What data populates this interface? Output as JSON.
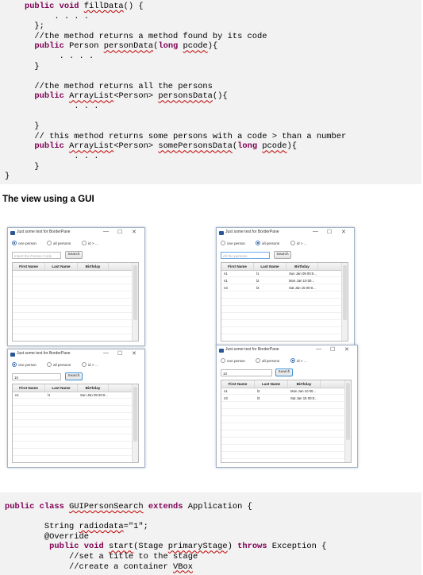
{
  "top_code": [
    [
      {
        "t": "    "
      },
      {
        "t": "public void ",
        "c": "kw"
      },
      {
        "t": "fillData",
        "c": "sq"
      },
      {
        "t": "() {"
      }
    ],
    [
      {
        "t": "          . . . ."
      }
    ],
    [
      {
        "t": "      };"
      }
    ],
    [
      {
        "t": "      //the method returns a method found by its code",
        "c": "cmt"
      }
    ],
    [
      {
        "t": "      "
      },
      {
        "t": "public ",
        "c": "kw"
      },
      {
        "t": "Person "
      },
      {
        "t": "personData",
        "c": "sq"
      },
      {
        "t": "("
      },
      {
        "t": "long ",
        "c": "kw"
      },
      {
        "t": "pcode",
        "c": "sq"
      },
      {
        "t": "){"
      }
    ],
    [
      {
        "t": "           . . . ."
      }
    ],
    [
      {
        "t": "      }"
      }
    ],
    [
      {
        "t": ""
      }
    ],
    [
      {
        "t": "      //the method returns all the persons",
        "c": "cmt"
      }
    ],
    [
      {
        "t": "      "
      },
      {
        "t": "public ",
        "c": "kw"
      },
      {
        "t": "ArrayList",
        "c": "sq"
      },
      {
        "t": "<Person> "
      },
      {
        "t": "personsData",
        "c": "sq"
      },
      {
        "t": "(){"
      }
    ],
    [
      {
        "t": "              . . ."
      }
    ],
    [
      {
        "t": ""
      }
    ],
    [
      {
        "t": "      }"
      }
    ],
    [
      {
        "t": "      // this method returns some persons with a code > than a number",
        "c": "cmt"
      }
    ],
    [
      {
        "t": "      "
      },
      {
        "t": "public ",
        "c": "kw"
      },
      {
        "t": "ArrayList",
        "c": "sq"
      },
      {
        "t": "<Person> "
      },
      {
        "t": "somePersonsData",
        "c": "sq"
      },
      {
        "t": "("
      },
      {
        "t": "long ",
        "c": "kw"
      },
      {
        "t": "pcode",
        "c": "sq"
      },
      {
        "t": "){"
      }
    ],
    [
      {
        "t": "              . . ."
      }
    ],
    [
      {
        "t": "      }"
      }
    ],
    [
      {
        "t": "}"
      }
    ]
  ],
  "heading": "The view using a GUI",
  "window_title": "Just some test for BorderPane",
  "window_controls": [
    "—",
    "☐",
    "✕"
  ],
  "radio_labels": [
    "one person",
    "all persons",
    "id > ..."
  ],
  "search_label": "Search",
  "columns": [
    "First Name",
    "Last Name",
    "Birthday"
  ],
  "windows": [
    {
      "selected": 0,
      "input": "",
      "placeholder": "Insert the Person Code",
      "rows": []
    },
    {
      "selected": 1,
      "input": "",
      "placeholder": "All the persons",
      "rows": [
        [
          "n1",
          "l1",
          "Sun Jan 09 00:0..."
        ],
        [
          "n1",
          "l2",
          "Mon Jan 10 00..."
        ],
        [
          "n3",
          "l3",
          "Sat Jan 15 00:0..."
        ]
      ]
    },
    {
      "selected": 0,
      "input": "10",
      "placeholder": "",
      "rows": [
        [
          "n1",
          "l1",
          "Sun Jan 09 00:0..."
        ]
      ]
    },
    {
      "selected": 2,
      "input": "10",
      "placeholder": "",
      "rows": [
        [
          "n1",
          "l2",
          "Mon Jan 10 00..."
        ],
        [
          "n3",
          "l3",
          "Sat Jan 15 00:0..."
        ]
      ]
    }
  ],
  "bottom_code": [
    [
      {
        "t": "public class ",
        "c": "kw"
      },
      {
        "t": "GUIPersonSearch",
        "c": "sq"
      },
      {
        "t": " "
      },
      {
        "t": "extends ",
        "c": "kw"
      },
      {
        "t": "Application {"
      }
    ],
    [
      {
        "t": ""
      }
    ],
    [
      {
        "t": "        String "
      },
      {
        "t": "radiodata",
        "c": "sq"
      },
      {
        "t": "=\"1\";"
      }
    ],
    [
      {
        "t": "        @Override"
      }
    ],
    [
      {
        "t": "         "
      },
      {
        "t": "public void ",
        "c": "kw"
      },
      {
        "t": "start",
        "c": "sq"
      },
      {
        "t": "(Stage "
      },
      {
        "t": "primaryStage",
        "c": "sq"
      },
      {
        "t": ") "
      },
      {
        "t": "throws ",
        "c": "kw"
      },
      {
        "t": "Exception {"
      }
    ],
    [
      {
        "t": "             //set a title to the stage",
        "c": "cmt"
      }
    ],
    [
      {
        "t": "             //create a container "
      },
      {
        "t": "VBox",
        "c": "sq"
      }
    ]
  ]
}
